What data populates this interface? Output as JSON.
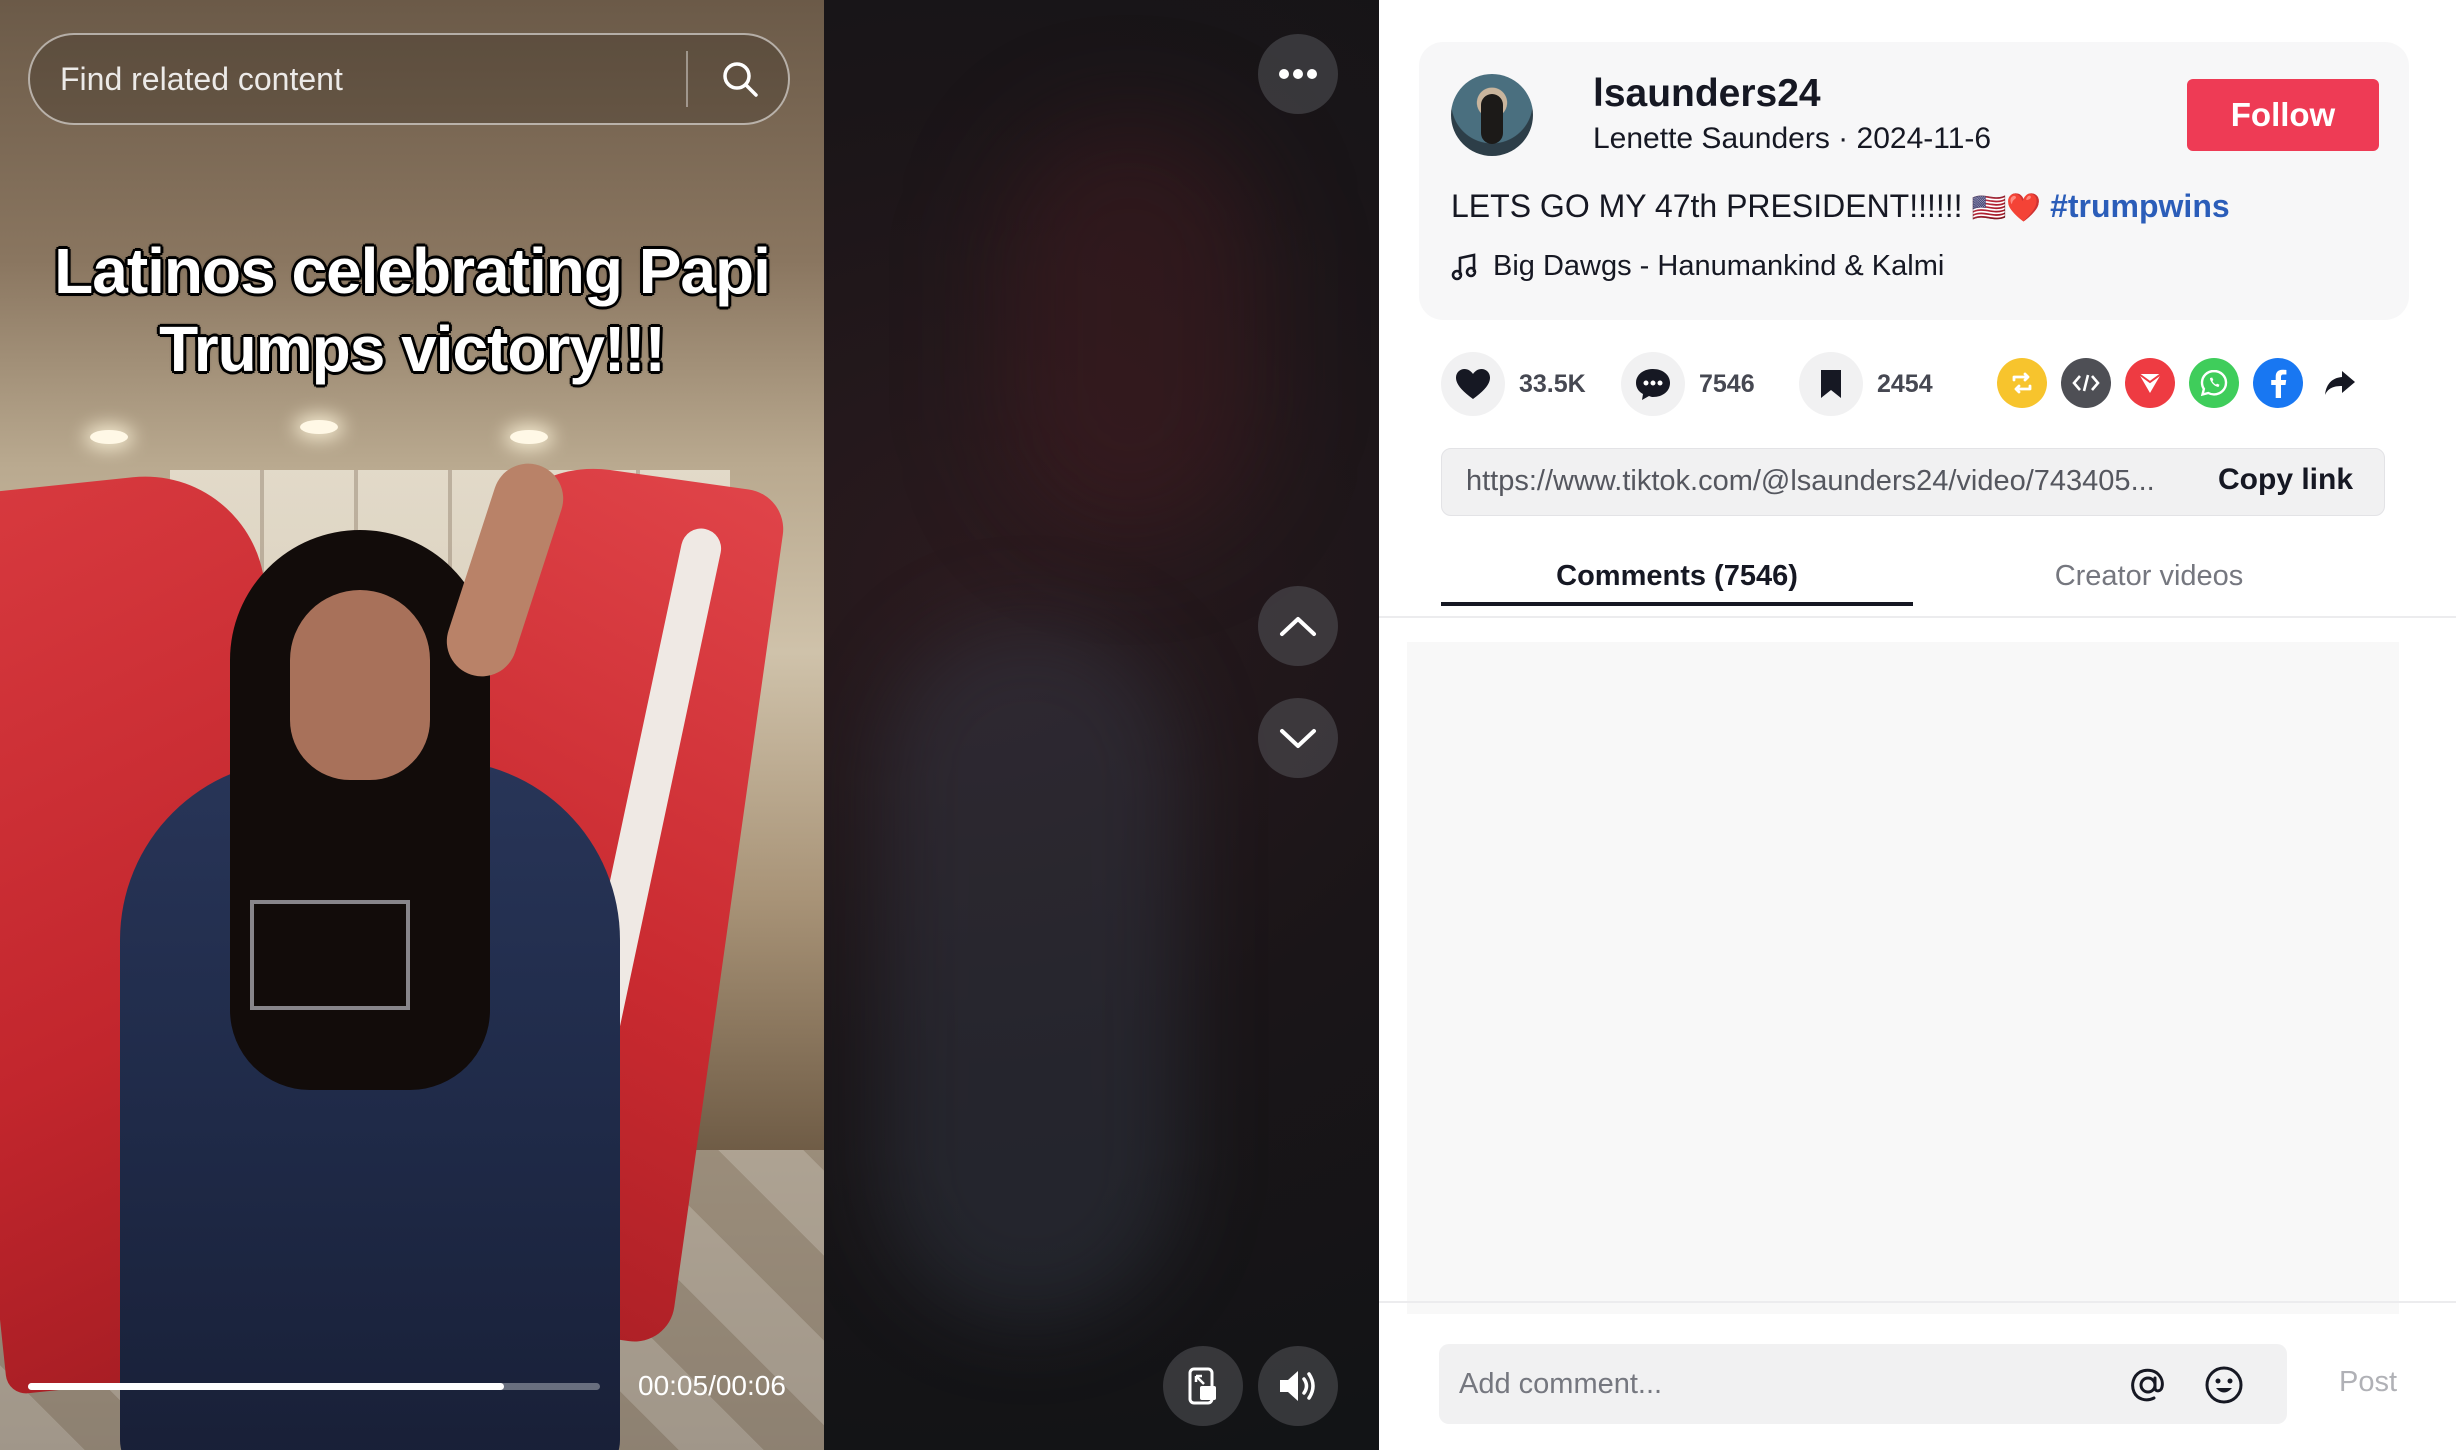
{
  "video": {
    "search_placeholder": "Find related content",
    "caption_line1": "Latinos celebrating Papi",
    "caption_line2": "Trumps victory!!!",
    "time": "00:05/00:06",
    "progress": 0.833,
    "icons": {
      "search": "search-icon",
      "more": "more-dots-icon",
      "prev": "chevron-up-icon",
      "next": "chevron-down-icon",
      "floating": "floating-player-icon",
      "volume": "volume-icon"
    }
  },
  "author": {
    "username": "lsaunders24",
    "subline": "Lenette Saunders · 2024-11-6",
    "follow_label": "Follow"
  },
  "post": {
    "description": "LETS GO MY 47th PRESIDENT!!!!!! ",
    "emoji": "🇺🇸❤️",
    "hashtag": "#trumpwins",
    "music": "Big Dawgs - Hanumankind & Kalmi"
  },
  "actions": {
    "likes": "33.5K",
    "comments": "7546",
    "saves": "2454"
  },
  "share": {
    "url": "https://www.tiktok.com/@lsaunders24/video/743405...",
    "copy_label": "Copy link",
    "icons": [
      "repost-icon",
      "embed-icon",
      "send-icon",
      "whatsapp-icon",
      "facebook-icon",
      "share-arrow-icon"
    ]
  },
  "tabs": {
    "comments_label": "Comments (7546)",
    "creator_label": "Creator videos"
  },
  "comment": {
    "placeholder": "Add comment...",
    "post_label": "Post"
  },
  "colors": {
    "follow": "#ee3b55",
    "hashtag": "#2b5db9",
    "repost": "#f7c42d",
    "embed": "#4e4f55",
    "send": "#ee3b42",
    "whatsapp": "#3fcd5b",
    "facebook": "#1877f2"
  }
}
